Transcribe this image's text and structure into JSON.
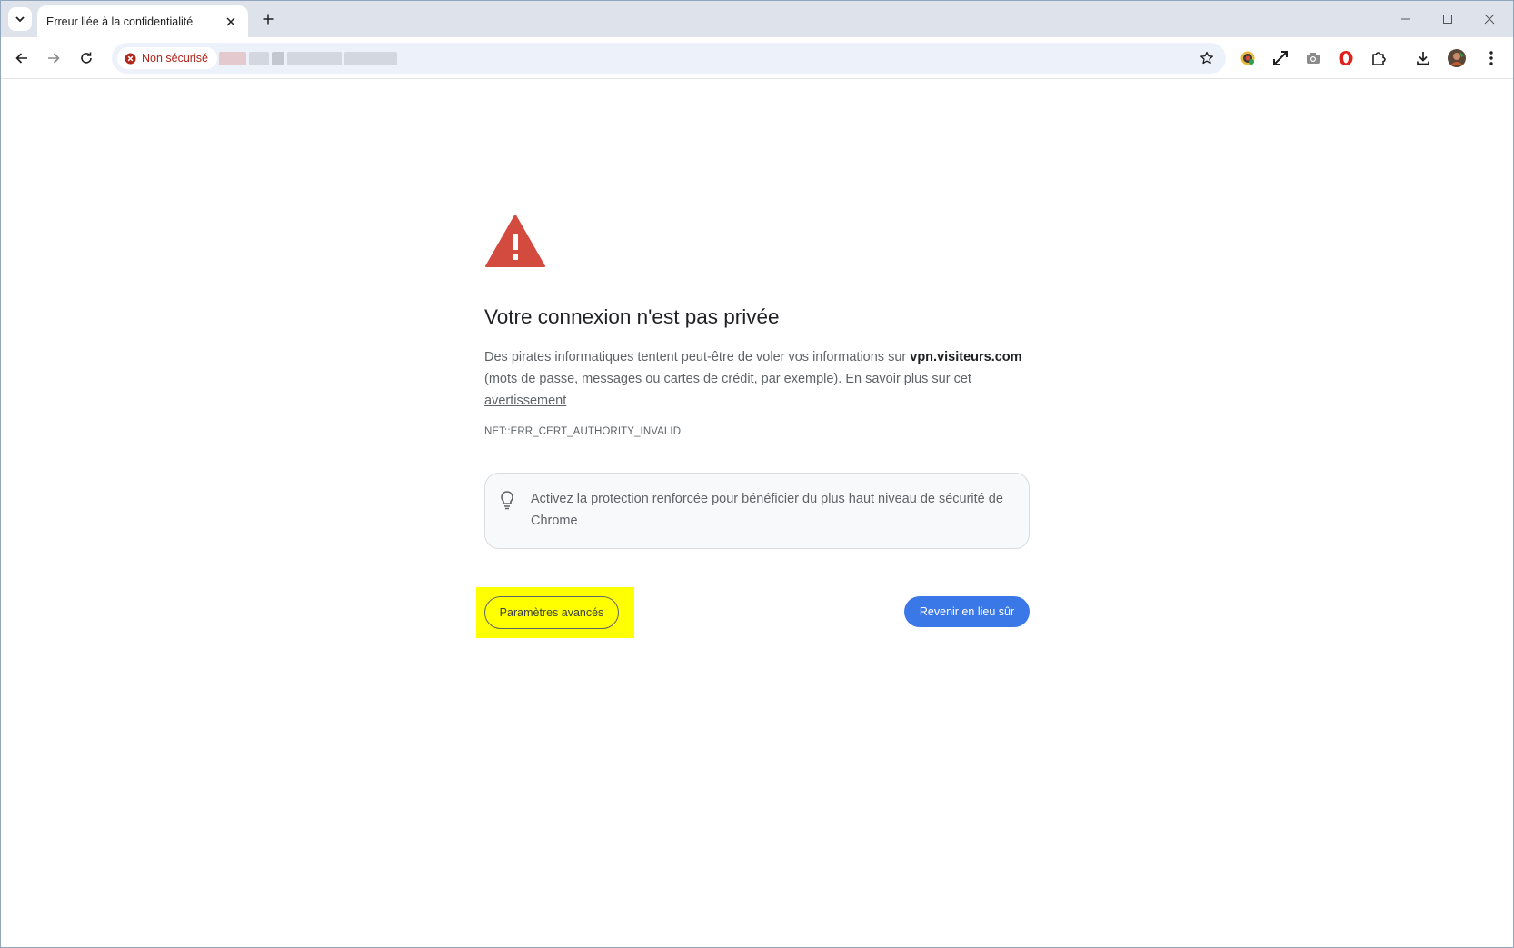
{
  "tab": {
    "title": "Erreur liée à la confidentialité"
  },
  "omnibox": {
    "security_label": "Non sécurisé"
  },
  "error_page": {
    "heading": "Votre connexion n'est pas privée",
    "para_part1": "Des pirates informatiques tentent peut-être de voler vos informations sur ",
    "domain": "vpn.visiteurs.com",
    "para_part2": " (mots de passe, messages ou cartes de crédit, par exemple). ",
    "learn_more": "En savoir plus sur cet avertissement",
    "error_code": "NET::ERR_CERT_AUTHORITY_INVALID",
    "tip_link": "Activez la protection renforcée",
    "tip_rest": " pour bénéficier du plus haut niveau de sécurité de Chrome",
    "advanced_button": "Paramètres avancés",
    "back_button": "Revenir en lieu sûr"
  },
  "colors": {
    "warning_red": "#d34b3f",
    "primary_blue": "#3b78e7",
    "highlight_yellow": "#ffff00",
    "insecure_red": "#b3261e"
  },
  "icons": {
    "tabstrip": [
      "tab-search-icon",
      "tab-close-icon",
      "new-tab-icon",
      "minimize-icon",
      "maximize-icon",
      "close-window-icon"
    ],
    "toolbar": [
      "back-icon",
      "forward-icon",
      "reload-icon",
      "not-secure-icon",
      "bookmark-star-icon",
      "extension-colorful-icon",
      "fullscreen-icon",
      "camera-icon",
      "opera-icon",
      "extensions-puzzle-icon",
      "download-icon",
      "profile-avatar",
      "menu-dots-icon"
    ],
    "content": [
      "warning-triangle-icon",
      "lightbulb-icon"
    ]
  }
}
